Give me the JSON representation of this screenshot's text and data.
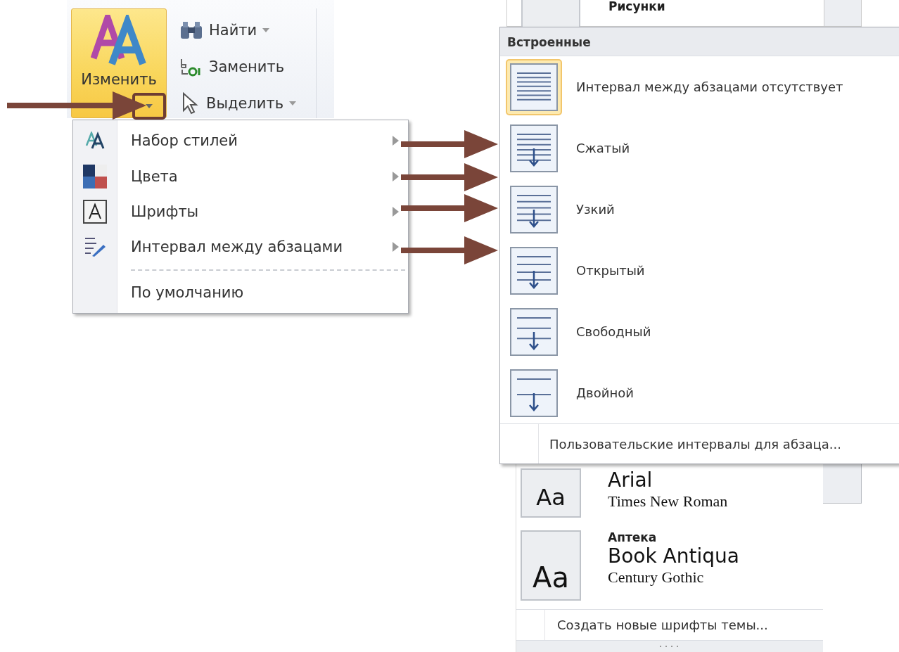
{
  "ribbon": {
    "change_styles": {
      "label": "Изменить"
    },
    "commands": [
      {
        "label": "Найти",
        "dropdown": true
      },
      {
        "label": "Заменить",
        "dropdown": false
      },
      {
        "label": "Выделить",
        "dropdown": true
      }
    ]
  },
  "styles_menu": {
    "items": [
      {
        "label": "Набор стилей",
        "submenu": true
      },
      {
        "label": "Цвета",
        "submenu": true
      },
      {
        "label": "Шрифты",
        "submenu": true
      },
      {
        "label": "Интервал между абзацами",
        "submenu": true
      }
    ],
    "footer_item": {
      "label": "По умолчанию"
    }
  },
  "background_gallery": {
    "theme_name": "Рисунки"
  },
  "spacing_gallery": {
    "heading": "Встроенные",
    "options": [
      {
        "label": "Интервал между абзацами отсутствует",
        "selected": true
      },
      {
        "label": "Сжатый",
        "selected": false
      },
      {
        "label": "Узкий",
        "selected": false
      },
      {
        "label": "Открытый",
        "selected": false
      },
      {
        "label": "Свободный",
        "selected": false
      },
      {
        "label": "Двойной",
        "selected": false
      }
    ],
    "footer": {
      "label": "Пользовательские интервалы для абзаца..."
    }
  },
  "font_gallery": {
    "themes": [
      {
        "preview": "Aa",
        "heading_font": "Arial",
        "body_font": "Times New Roman"
      },
      {
        "preview": "Aa",
        "name": "Аптека",
        "heading_font": "Book Antiqua",
        "body_font": "Century Gothic"
      }
    ],
    "footer": {
      "label": "Создать новые шрифты темы..."
    }
  }
}
